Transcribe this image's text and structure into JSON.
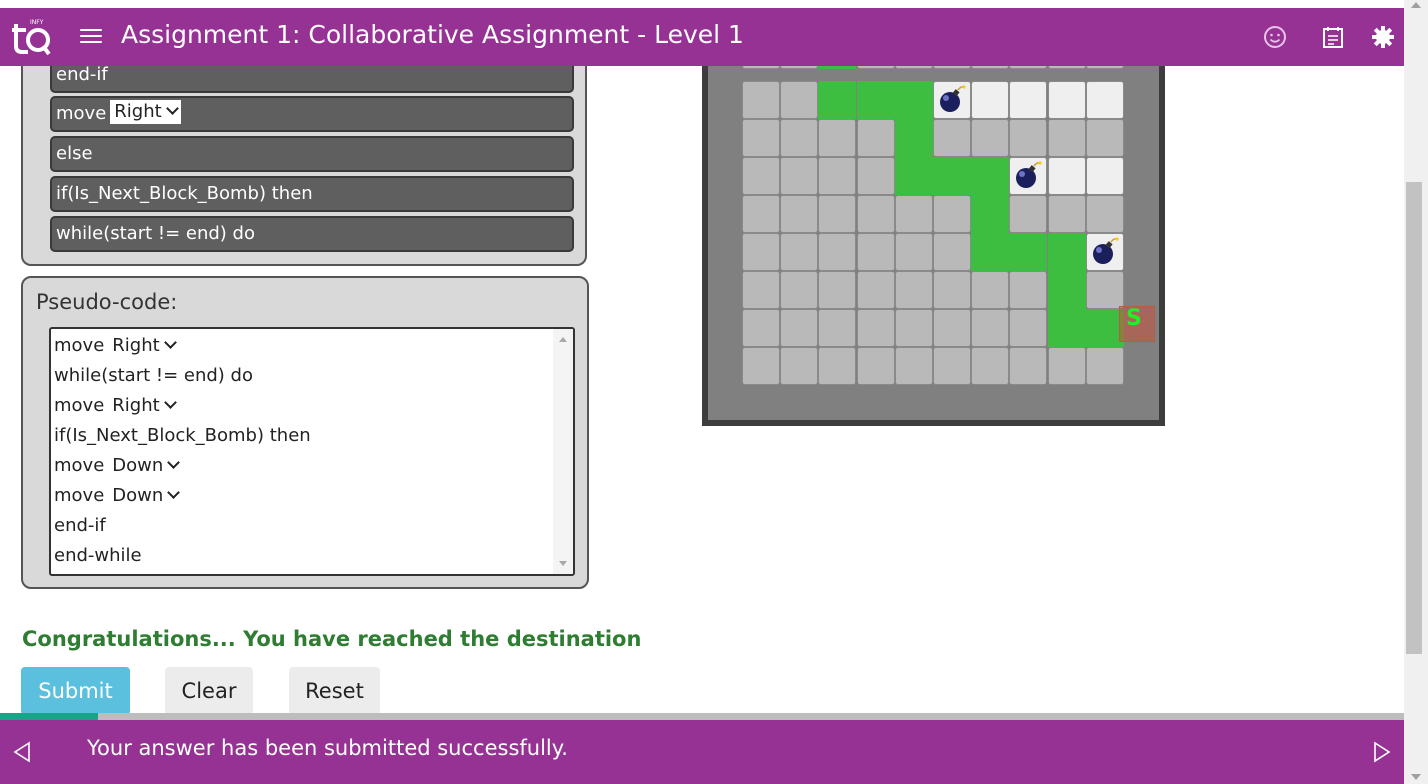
{
  "header": {
    "title": "Assignment 1: Collaborative Assignment - Level 1",
    "logo_text": "INFY",
    "bg_color": "#953294"
  },
  "icons": {
    "logo": "tq-logo-icon",
    "menu": "hamburger-menu-icon",
    "smiley": "smiley-icon",
    "calendar": "calendar-icon",
    "settings": "gear-icon"
  },
  "blocks": [
    {
      "text": "end-if"
    },
    {
      "text": "move",
      "select": "Right"
    },
    {
      "text": "else"
    },
    {
      "text": "if(Is_Next_Block_Bomb) then"
    },
    {
      "text": "while(start != end) do"
    }
  ],
  "pseudo": {
    "title": "Pseudo-code:",
    "lines": [
      {
        "text": "move",
        "select": "Right"
      },
      {
        "text": "while(start != end) do"
      },
      {
        "text": "move",
        "select": "Right"
      },
      {
        "text": "if(Is_Next_Block_Bomb) then"
      },
      {
        "text": "move",
        "select": "Down"
      },
      {
        "text": "move",
        "select": "Down"
      },
      {
        "text": "end-if"
      },
      {
        "text": "end-while"
      }
    ]
  },
  "board": {
    "start_label": "S",
    "path_color": "#3dbe41",
    "bomb_icon": "bomb-icon"
  },
  "status": {
    "message": "Congratulations... You have reached the destination",
    "color": "#2e7d32"
  },
  "buttons": {
    "submit": "Submit",
    "clear": "Clear",
    "reset": "Reset"
  },
  "progress": {
    "fraction": 0.07
  },
  "footer": {
    "message": "Your answer has been submitted successfully.",
    "prev_icon": "triangle-left-icon",
    "next_icon": "triangle-right-icon"
  }
}
